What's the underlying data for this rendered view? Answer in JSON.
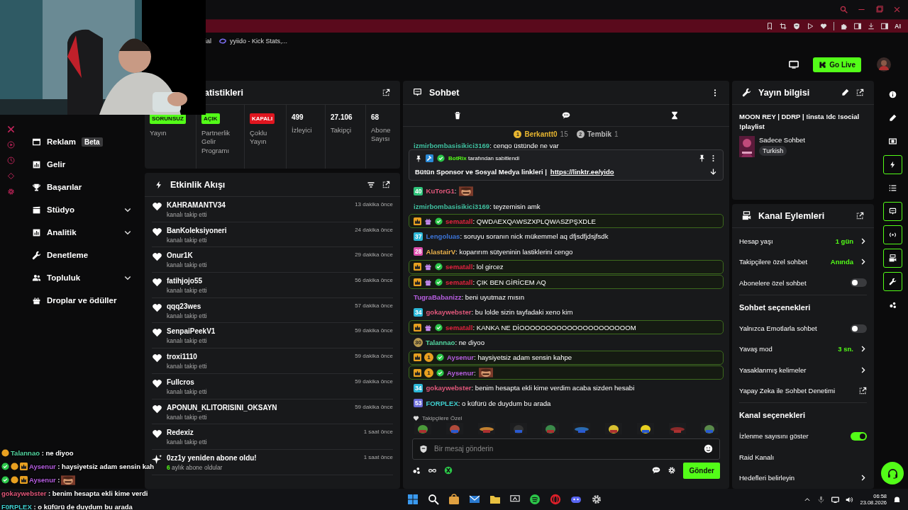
{
  "browser": {
    "bookmarks": [
      {
        "label": "ial",
        "kind": "plain"
      },
      {
        "label": "yyiido - Kick Stats,...",
        "kind": "site"
      }
    ],
    "ext_label": "AI"
  },
  "header": {
    "go_live": "Go Live"
  },
  "sidebar": {
    "items": [
      {
        "label": "Reklam",
        "badge": "Beta",
        "expandable": false
      },
      {
        "label": "Gelir",
        "expandable": false
      },
      {
        "label": "Başarılar",
        "expandable": false
      },
      {
        "label": "Stüdyo",
        "expandable": true
      },
      {
        "label": "Analitik",
        "expandable": true
      },
      {
        "label": "Denetleme",
        "expandable": false
      },
      {
        "label": "Topluluk",
        "expandable": true
      },
      {
        "label": "Droplar ve ödüller",
        "expandable": false
      }
    ]
  },
  "stats": {
    "title": "atistikleri",
    "cells": [
      {
        "kind": "badge",
        "value": "SORUNSUZ",
        "color": "#53fc18",
        "caption": "Yayın"
      },
      {
        "kind": "badge",
        "value": "AÇIK",
        "color": "#53fc18",
        "caption": "Partnerlik Gelir Programı"
      },
      {
        "kind": "badge",
        "value": "KAPALI",
        "color": "#e0151f",
        "caption": "Çoklu Yayın"
      },
      {
        "kind": "number",
        "value": "499",
        "caption": "İzleyici"
      },
      {
        "kind": "number",
        "value": "27.106",
        "caption": "Takipçi"
      },
      {
        "kind": "number",
        "value": "68",
        "caption": "Abone Sayısı"
      }
    ]
  },
  "activity": {
    "title": "Etkinlik Akışı",
    "events": [
      {
        "kind": "follow",
        "name": "KAHRAMANTV34",
        "detail": "kanalı takip etti",
        "time": "13 dakika önce"
      },
      {
        "kind": "follow",
        "name": "BanKoleksiyoneri",
        "detail": "kanalı takip etti",
        "time": "24 dakika önce"
      },
      {
        "kind": "follow",
        "name": "Onur1K",
        "detail": "kanalı takip etti",
        "time": "29 dakika önce"
      },
      {
        "kind": "follow",
        "name": "fatihjojo55",
        "detail": "kanalı takip etti",
        "time": "56 dakika önce"
      },
      {
        "kind": "follow",
        "name": "qqq23wes",
        "detail": "kanalı takip etti",
        "time": "57 dakika önce"
      },
      {
        "kind": "follow",
        "name": "SenpaiPeekV1",
        "detail": "kanalı takip etti",
        "time": "59 dakika önce"
      },
      {
        "kind": "follow",
        "name": "troxi1110",
        "detail": "kanalı takip etti",
        "time": "59 dakika önce"
      },
      {
        "kind": "follow",
        "name": "Fullcros",
        "detail": "kanalı takip etti",
        "time": "59 dakika önce"
      },
      {
        "kind": "follow",
        "name": "APONUN_KLITORISINI_OKSAYN",
        "detail": "kanalı takip etti",
        "time": "59 dakika önce"
      },
      {
        "kind": "follow",
        "name": "Redexiz",
        "detail": "kanalı takip etti",
        "time": "1 saat önce"
      },
      {
        "kind": "resub",
        "name": "0zz1y yeniden abone oldu!",
        "months": "6",
        "detail": "aylık abone oldular",
        "time": "1 saat önce"
      }
    ]
  },
  "chat": {
    "title": "Sohbet",
    "leaders": [
      {
        "rank": "1",
        "name": "Berkantt0",
        "count": "15",
        "color": "#e8b630"
      },
      {
        "rank": "2",
        "name": "Tembik",
        "count": "1",
        "color": "#b8b8b8"
      }
    ],
    "pinned": {
      "by": "BotRix",
      "label": "tarafından sabitlendi",
      "text": "Bütün Sponsor ve Sosyal Medya linkleri |",
      "link": "https://linktr.ee/yido"
    },
    "before_pin": {
      "user": "izmirbombasisikici3169",
      "color": "#3fbf9f",
      "text": ": cengo üstünde ne var"
    },
    "messages": [
      {
        "user": "KuTorG1",
        "color": "#e0577a",
        "text": ":",
        "emote": true,
        "highlighted": false,
        "badges": [
          {
            "kind": "sub",
            "label": "40",
            "color": "#2fc47a"
          }
        ]
      },
      {
        "user": "izmirbombasisikici3169",
        "color": "#3fbf9f",
        "text": ": teyzemisin amk",
        "highlighted": false
      },
      {
        "user": "sematall",
        "color": "#e0223f",
        "text": ": QWDAEXQAWSZXPLQWASZPŞXDLE",
        "highlighted": true,
        "badges": [
          {
            "kind": "crown"
          },
          {
            "kind": "gift"
          },
          {
            "kind": "verified"
          }
        ]
      },
      {
        "user": "Lengoluas",
        "color": "#3c74d8",
        "text": ": soruyu soranın nick mükemmel aq dfjsdfjdsjfsdk",
        "highlighted": false,
        "badges": [
          {
            "kind": "sub",
            "label": "37",
            "color": "#2cb8d8"
          }
        ]
      },
      {
        "user": "AlastairV",
        "color": "#e8b04a",
        "text": ": koparırım sütyeninin lastiklerini cengo",
        "highlighted": false,
        "badges": [
          {
            "kind": "sub",
            "label": "28",
            "color": "#e050b0"
          }
        ]
      },
      {
        "user": "sematall",
        "color": "#e0223f",
        "text": ": lol gircez",
        "highlighted": true,
        "badges": [
          {
            "kind": "crown"
          },
          {
            "kind": "gift"
          },
          {
            "kind": "verified"
          }
        ]
      },
      {
        "user": "sematall",
        "color": "#e0223f",
        "text": ": ÇIK BEN GİRİCEM AQ",
        "highlighted": true,
        "badges": [
          {
            "kind": "crown"
          },
          {
            "kind": "gift"
          },
          {
            "kind": "verified"
          }
        ]
      },
      {
        "user": "TugraBabanizz",
        "color": "#b65ee0",
        "text": ": beni uyutmaz mısın",
        "highlighted": false
      },
      {
        "user": "gokaywebster",
        "color": "#e0577a",
        "text": ": bu lolde sizin tayfadaki xeno kim",
        "highlighted": false,
        "badges": [
          {
            "kind": "sub",
            "label": "34",
            "color": "#2cb8d8"
          }
        ]
      },
      {
        "user": "sematall",
        "color": "#e0223f",
        "text": ": KANKA NE DİOOOOOOOOOOOOOOOOOOOOOM",
        "highlighted": true,
        "badges": [
          {
            "kind": "crown"
          },
          {
            "kind": "gift"
          },
          {
            "kind": "verified"
          }
        ]
      },
      {
        "user": "Talannao",
        "color": "#53d6a0",
        "text": ": ne diyoo",
        "highlighted": false,
        "badges": [
          {
            "kind": "coin",
            "label": "30",
            "color": "#b89a50"
          }
        ]
      },
      {
        "user": "Aysenur",
        "color": "#b65ee0",
        "text": ": haysiyetsiz adam sensin kahpe",
        "highlighted": true,
        "badges": [
          {
            "kind": "crown"
          },
          {
            "kind": "coin",
            "label": "1",
            "color": "#e8a020"
          },
          {
            "kind": "verified"
          }
        ]
      },
      {
        "user": "Aysenur",
        "color": "#b65ee0",
        "text": ":",
        "emote": true,
        "highlighted": true,
        "badges": [
          {
            "kind": "crown"
          },
          {
            "kind": "coin",
            "label": "1",
            "color": "#e8a020"
          },
          {
            "kind": "verified"
          }
        ]
      },
      {
        "user": "gokaywebster",
        "color": "#e0577a",
        "text": ": benim hesapta ekli kime verdim acaba sizden hesabi",
        "highlighted": false,
        "badges": [
          {
            "kind": "sub",
            "label": "34",
            "color": "#2cb8d8"
          }
        ]
      },
      {
        "user": "FORPLEX",
        "color": "#3fd0d0",
        "text": ": o küfürü de duydum bu arada",
        "highlighted": false,
        "badges": [
          {
            "kind": "sub",
            "label": "53",
            "color": "#6a6ad8"
          }
        ]
      }
    ],
    "emote_section": "Takipçilere Özel",
    "input": {
      "placeholder": "Bir mesaj gönderin"
    },
    "send": "Gönder"
  },
  "stream_info": {
    "title": "Yayın bilgisi",
    "stream_title": "MOON REY | DDRP | !insta !dc !social !playlist",
    "category": "Sadece Sohbet",
    "tag": "Turkish"
  },
  "channel_actions": {
    "title": "Kanal Eylemleri",
    "items": [
      {
        "kind": "value",
        "label": "Hesap yaşı",
        "value": "1 gün"
      },
      {
        "kind": "value",
        "label": "Takipçilere özel sohbet",
        "value": "Anında"
      },
      {
        "kind": "toggle",
        "label": "Abonelere özel sohbet",
        "on": false
      },
      {
        "kind": "heading",
        "label": "Sohbet seçenekleri"
      },
      {
        "kind": "toggle",
        "label": "Yalnızca Emotlarla sohbet",
        "on": false
      },
      {
        "kind": "value",
        "label": "Yavaş mod",
        "value": "3 sn."
      },
      {
        "kind": "link",
        "label": "Yasaklanmış kelimeler"
      },
      {
        "kind": "external",
        "label": "Yapay Zeka ile Sohbet Denetimi"
      },
      {
        "kind": "heading",
        "label": "Kanal seçenekleri"
      },
      {
        "kind": "toggle",
        "label": "İzlenme sayısını göster",
        "on": true
      },
      {
        "kind": "plain",
        "label": "Raid Kanalı"
      },
      {
        "kind": "link",
        "label": "Hedefleri belirleyin"
      }
    ]
  },
  "rail": [
    {
      "selected": false
    },
    {
      "selected": false
    },
    {
      "selected": false
    },
    {
      "selected": true
    },
    {
      "selected": false
    },
    {
      "selected": true
    },
    {
      "selected": true
    },
    {
      "selected": true
    },
    {
      "selected": true
    },
    {
      "selected": false
    }
  ],
  "overlay_chat": [
    {
      "user": "Talannao",
      "color": "#53d6a0",
      "text": " : ne diyoo",
      "badges": [
        {
          "kind": "coin"
        }
      ]
    },
    {
      "user": "Aysenur",
      "color": "#b65ee0",
      "text": " : haysiyetsiz adam sensin kah",
      "badges": [
        {
          "kind": "verified"
        },
        {
          "kind": "coin"
        },
        {
          "kind": "crown"
        }
      ]
    },
    {
      "user": "Aysenur",
      "color": "#b65ee0",
      "text": " :",
      "emote": true,
      "badges": [
        {
          "kind": "verified"
        },
        {
          "kind": "coin"
        },
        {
          "kind": "crown"
        }
      ]
    },
    {
      "user": "gokaywebster",
      "color": "#e0577a",
      "text": " : benim hesapta ekli kime verdi"
    },
    {
      "user": "F0RPLEX",
      "color": "#3fd0d0",
      "text": " : o küfürü de duydum bu arada"
    }
  ],
  "taskbar": {
    "time": "06:58",
    "date": "23.08.2026"
  }
}
